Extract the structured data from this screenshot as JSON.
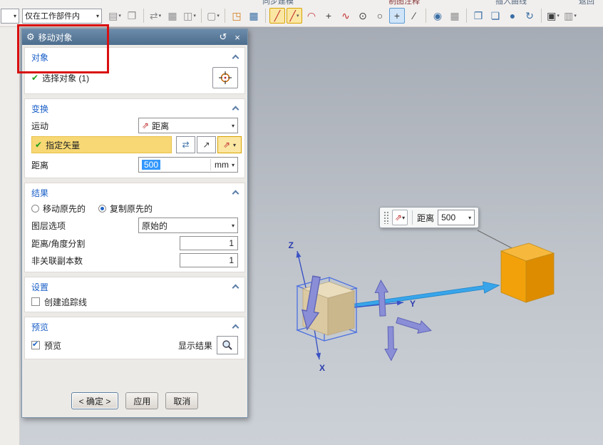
{
  "top": {
    "fragments": [
      "同步建模",
      "制图注释",
      "插入曲线",
      "返回"
    ],
    "scope_combo_value": "仅在工作部件内",
    "icons": [
      {
        "name": "paste-special-icon",
        "glyph": "▤",
        "cls": "gray",
        "dd": true
      },
      {
        "name": "copy-display-icon",
        "glyph": "❐",
        "cls": "gray"
      },
      {
        "sep": true
      },
      {
        "name": "move-component-icon",
        "glyph": "⇄",
        "cls": "gray",
        "dd": true
      },
      {
        "name": "pattern-component-icon",
        "glyph": "▦",
        "cls": "gray"
      },
      {
        "name": "mirror-assembly-icon",
        "glyph": "◫",
        "cls": "gray",
        "dd": true
      },
      {
        "sep": true
      },
      {
        "name": "exploded-view-icon",
        "glyph": "▢",
        "cls": "gray",
        "dd": true
      },
      {
        "sep": true
      },
      {
        "name": "datum-csys-icon",
        "glyph": "◳",
        "cls": "orange"
      },
      {
        "name": "pattern-geometry-icon",
        "glyph": "▦",
        "cls": "blue"
      },
      {
        "sep": true
      },
      {
        "name": "profile-line-icon",
        "glyph": "╱",
        "cls": "red",
        "state": "hl-yellow"
      },
      {
        "name": "line-icon",
        "glyph": "╱",
        "cls": "red",
        "state": "hl-yellow",
        "dd": true
      },
      {
        "name": "arc-icon",
        "glyph": "◠",
        "cls": "red"
      },
      {
        "name": "point-icon",
        "glyph": "+",
        "cls": "dark"
      },
      {
        "name": "studio-spline-icon",
        "glyph": "∿",
        "cls": "red"
      },
      {
        "name": "circle-icon",
        "glyph": "⊙",
        "cls": "dark"
      },
      {
        "name": "ellipse-icon",
        "glyph": "○",
        "cls": "dark"
      },
      {
        "name": "plus-snap-icon",
        "glyph": "+",
        "cls": "dark",
        "state": "hl-blue"
      },
      {
        "name": "line-segment-icon",
        "glyph": "∕",
        "cls": "dark"
      },
      {
        "sep": true
      },
      {
        "name": "snap-point-icon",
        "glyph": "◉",
        "cls": "blue"
      },
      {
        "name": "part-table-icon",
        "glyph": "▦",
        "cls": "gray"
      },
      {
        "sep": true
      },
      {
        "name": "window-cascade-icon",
        "glyph": "❐",
        "cls": "blue"
      },
      {
        "name": "window-tile-icon",
        "glyph": "❏",
        "cls": "blue"
      },
      {
        "name": "sphere-icon",
        "glyph": "●",
        "cls": "blue"
      },
      {
        "name": "rotate-view-icon",
        "glyph": "↻",
        "cls": "blue"
      },
      {
        "sep": true
      },
      {
        "name": "section-view-icon",
        "glyph": "▣",
        "cls": "dark",
        "dd": true
      },
      {
        "name": "cylinder-icon",
        "glyph": "▥",
        "cls": "gray",
        "dd": true
      }
    ]
  },
  "ui_icons": {
    "gear": "⚙",
    "reset": "↺",
    "close": "×",
    "check": "✔",
    "dropdown": "▾",
    "vector": "⇗",
    "two_axis": "⇄",
    "point_arrow": "↗"
  },
  "dialog": {
    "title": "移动对象",
    "object_section": {
      "header": "对象",
      "select_object": "选择对象 (1)"
    },
    "transform_section": {
      "header": "变换",
      "motion_label": "运动",
      "motion_value": "距离",
      "vector_label": "指定矢量",
      "distance_label": "距离",
      "distance_value": "500",
      "distance_unit": "mm"
    },
    "result_section": {
      "header": "结果",
      "move_original": "移动原先的",
      "copy_original": "复制原先的",
      "layer_label": "图层选项",
      "layer_value": "原始的",
      "division_label": "距离/角度分割",
      "division_value": "1",
      "copies_label": "非关联副本数",
      "copies_value": "1"
    },
    "settings_section": {
      "header": "设置",
      "tracking_checkbox": "创建追踪线"
    },
    "preview_section": {
      "header": "预览",
      "preview_checkbox": "预览",
      "show_result": "显示结果"
    },
    "buttons": {
      "ok": "< 确定 >",
      "apply": "应用",
      "cancel": "取消"
    }
  },
  "viewport": {
    "mini_toolbar": {
      "distance_label": "距离",
      "distance_value": "500"
    },
    "axis_labels": {
      "z": "Z",
      "y": "Y",
      "x": "X"
    }
  },
  "colors": {
    "vector_row_highlight": "#f7d874",
    "selection_blue": "#3297fd",
    "original_cube": "#dbc9a2",
    "copied_cube": "#f2a10a",
    "annotation_red": "#d90f0f",
    "dialog_header": "#4d6d8d"
  }
}
